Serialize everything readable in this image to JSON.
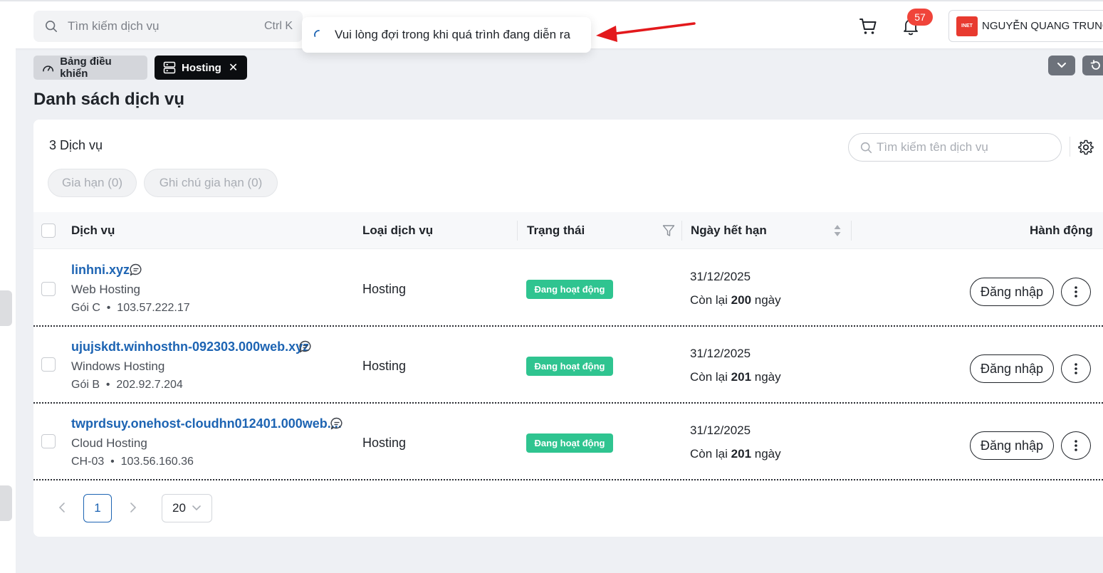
{
  "header": {
    "search_placeholder": "Tìm kiếm dịch vụ",
    "search_shortcut": "Ctrl K",
    "toast_text": "Vui lòng đợi trong khi quá trình đang diễn ra",
    "notification_count": "57",
    "user_logo_text": "INET",
    "user_name": "NGUYỄN QUANG TRUNG"
  },
  "tabs": {
    "dashboard_label": "Bảng điều khiển",
    "hosting_label": "Hosting"
  },
  "page": {
    "title": "Danh sách dịch vụ",
    "service_count": "3 Dịch vụ",
    "renew_button": "Gia hạn (0)",
    "renew_note_button": "Ghi chú gia hạn (0)",
    "search_placeholder": "Tìm kiếm tên dịch vụ"
  },
  "table": {
    "columns": {
      "service": "Dịch vụ",
      "type": "Loại dịch vụ",
      "status": "Trạng thái",
      "expiry": "Ngày hết hạn",
      "action": "Hành động"
    },
    "rows": [
      {
        "name": "linhni.xyz",
        "product": "Web Hosting",
        "plan": "Gói C",
        "ip": "103.57.222.17",
        "kind": "Hosting",
        "status": "Đang hoạt động",
        "expiry_date": "31/12/2025",
        "remaining_prefix": "Còn lại",
        "remaining_days": "200",
        "remaining_suffix": "ngày",
        "login": "Đăng nhập"
      },
      {
        "name": "ujujskdt.winhosthn-092303.000web.xyz",
        "product": "Windows Hosting",
        "plan": "Gói B",
        "ip": "202.92.7.204",
        "kind": "Hosting",
        "status": "Đang hoạt động",
        "expiry_date": "31/12/2025",
        "remaining_prefix": "Còn lại",
        "remaining_days": "201",
        "remaining_suffix": "ngày",
        "login": "Đăng nhập"
      },
      {
        "name": "twprdsuy.onehost-cloudhn012401.000web....",
        "product": "Cloud Hosting",
        "plan": "CH-03",
        "ip": "103.56.160.36",
        "kind": "Hosting",
        "status": "Đang hoạt động",
        "expiry_date": "31/12/2025",
        "remaining_prefix": "Còn lại",
        "remaining_days": "201",
        "remaining_suffix": "ngày",
        "login": "Đăng nhập"
      }
    ]
  },
  "pagination": {
    "current_page": "1",
    "page_size": "20"
  },
  "colors": {
    "accent": "#1d64b3",
    "status_active": "#2fc490",
    "badge": "#f0443a",
    "annotation_arrow": "#e3191c"
  }
}
